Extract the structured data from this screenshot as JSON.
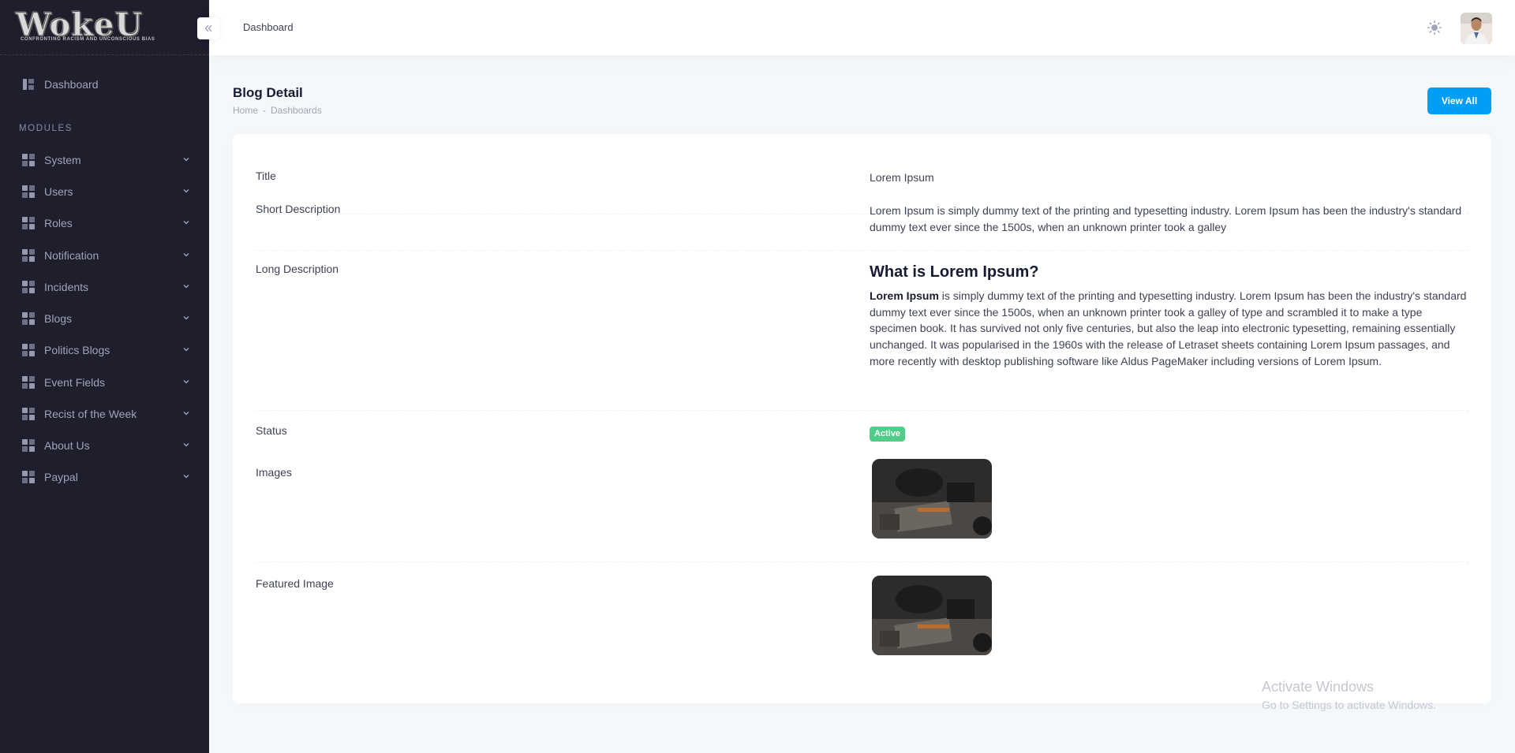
{
  "brand": {
    "logo_text": "WokeU",
    "tagline": "CONFRONTING RACISM AND UNCONSCIOUS BIAS"
  },
  "sidebar": {
    "dashboard_label": "Dashboard",
    "section_label": "MODULES",
    "items": [
      {
        "label": "System"
      },
      {
        "label": "Users"
      },
      {
        "label": "Roles"
      },
      {
        "label": "Notification"
      },
      {
        "label": "Incidents"
      },
      {
        "label": "Blogs"
      },
      {
        "label": "Politics Blogs"
      },
      {
        "label": "Event Fields"
      },
      {
        "label": "Recist of the Week"
      },
      {
        "label": "About Us"
      },
      {
        "label": "Paypal"
      }
    ]
  },
  "header": {
    "breadcrumb": "Dashboard"
  },
  "toolbar": {
    "title": "Blog Detail",
    "breadcrumb": [
      "Home",
      "-",
      "Dashboards"
    ],
    "view_all_label": "View All"
  },
  "detail": {
    "title_label": "Title",
    "title_value": "Lorem Ipsum",
    "short_desc_label": "Short Description",
    "short_desc_value": "Lorem Ipsum is simply dummy text of the printing and typesetting industry. Lorem Ipsum has been the industry's standard dummy text ever since the 1500s, when an unknown printer took a galley",
    "long_desc_label": "Long Description",
    "long_desc_heading": "What is Lorem Ipsum?",
    "long_desc_bold": "Lorem Ipsum",
    "long_desc_rest": " is simply dummy text of the printing and typesetting industry. Lorem Ipsum has been the industry's standard dummy text ever since the 1500s, when an unknown printer took a galley of type and scrambled it to make a type specimen book. It has survived not only five centuries, but also the leap into electronic typesetting, remaining essentially unchanged. It was popularised in the 1960s with the release of Letraset sheets containing Lorem Ipsum passages, and more recently with desktop publishing software like Aldus PageMaker including versions of Lorem Ipsum.",
    "status_label": "Status",
    "status_value": "Active",
    "status_color": "#50cd89",
    "images_label": "Images",
    "featured_label": "Featured Image"
  },
  "watermark": {
    "line1": "Activate Windows",
    "line2": "Go to Settings to activate Windows."
  },
  "colors": {
    "sidebar_bg": "#1e1e2d",
    "primary": "#009ef7",
    "page_bg": "#f5f8fa"
  }
}
